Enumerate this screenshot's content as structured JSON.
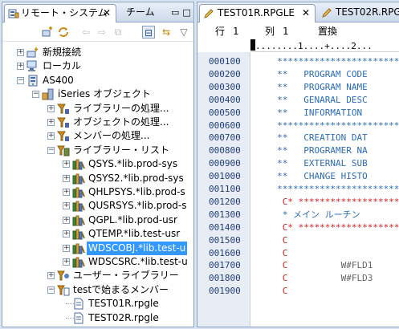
{
  "left_panel": {
    "tabs": [
      {
        "label": "リモート・システム",
        "icon": "remote-systems-icon",
        "active": true
      },
      {
        "label": "チーム",
        "active": false
      }
    ],
    "tree": [
      {
        "label": "新規接続",
        "icon": "new-connection-icon",
        "depth": 0,
        "expander": "+"
      },
      {
        "label": "ローカル",
        "icon": "local-icon",
        "depth": 0,
        "expander": "+"
      },
      {
        "label": "AS400",
        "icon": "server-icon",
        "depth": 0,
        "expander": "-"
      },
      {
        "label": "iSeries オブジェクト",
        "icon": "iseries-objects-icon",
        "depth": 1,
        "expander": "-"
      },
      {
        "label": "ライブラリーの処理...",
        "icon": "filter-icon",
        "depth": 2,
        "expander": "+"
      },
      {
        "label": "オブジェクトの処理...",
        "icon": "filter-icon",
        "depth": 2,
        "expander": "+"
      },
      {
        "label": "メンバーの処理...",
        "icon": "filter-icon",
        "depth": 2,
        "expander": "+"
      },
      {
        "label": "ライブラリー・リスト",
        "icon": "library-list-icon",
        "depth": 2,
        "expander": "-"
      },
      {
        "label": "QSYS.*lib.prod-sys",
        "icon": "library-icon",
        "depth": 3,
        "expander": "+"
      },
      {
        "label": "QSYS2.*lib.prod-sys",
        "icon": "library-icon",
        "depth": 3,
        "expander": "+"
      },
      {
        "label": "QHLPSYS.*lib.prod-s",
        "icon": "library-icon",
        "depth": 3,
        "expander": "+"
      },
      {
        "label": "QUSRSYS.*lib.prod-s",
        "icon": "library-icon",
        "depth": 3,
        "expander": "+"
      },
      {
        "label": "QGPL.*lib.prod-usr",
        "icon": "library-icon",
        "depth": 3,
        "expander": "+"
      },
      {
        "label": "QTEMP.*lib.test-usr",
        "icon": "library-icon",
        "depth": 3,
        "expander": "+"
      },
      {
        "label": "WDSCOBJ.*lib.test-u",
        "icon": "library-icon",
        "depth": 3,
        "expander": "+",
        "selected": true
      },
      {
        "label": "WDSCSRC.*lib.test-u",
        "icon": "library-icon",
        "depth": 3,
        "expander": "+"
      },
      {
        "label": "ユーザー・ライブラリー",
        "icon": "user-library-icon",
        "depth": 2,
        "expander": "+"
      },
      {
        "label": "testで始まるメンバー",
        "icon": "member-filter-icon",
        "depth": 2,
        "expander": "-"
      },
      {
        "label": "TEST01R.rpgle",
        "icon": "source-member-icon",
        "depth": 3,
        "expander": ""
      },
      {
        "label": "TEST02R.rpgle",
        "icon": "source-member-icon",
        "depth": 3,
        "expander": ""
      }
    ]
  },
  "editor": {
    "tabs": [
      {
        "label": "TEST01R.RPGLE",
        "icon": "pencil-icon",
        "active": true
      },
      {
        "label": "TEST02R.RPG",
        "icon": "pencil-icon",
        "active": false
      }
    ],
    "status": {
      "line_label": "行",
      "line_value": "1",
      "col_label": "列",
      "col_value": "1",
      "mode": "置換"
    },
    "ruler": "........1....+....2...",
    "lines": [
      {
        "seq": "000100",
        "spec": " ",
        "text": "     ***************************"
      },
      {
        "seq": "000200",
        "spec": " ",
        "text": "     **   PROGRAM CODE"
      },
      {
        "seq": "000300",
        "spec": " ",
        "text": "     **   PROGRAM NAME"
      },
      {
        "seq": "000400",
        "spec": " ",
        "text": "     **   GENARAL DESC"
      },
      {
        "seq": "000500",
        "spec": " ",
        "text": "     **   INFORMATION"
      },
      {
        "seq": "000600",
        "spec": " ",
        "text": "     ***************************"
      },
      {
        "seq": "000700",
        "spec": " ",
        "text": "     **   CREATION DAT"
      },
      {
        "seq": "000800",
        "spec": " ",
        "text": "     **   PROGRAMER NA"
      },
      {
        "seq": "000900",
        "spec": " ",
        "text": "     **   EXTERNAL SUB"
      },
      {
        "seq": "001000",
        "spec": " ",
        "text": "     **   CHANGE HISTO"
      },
      {
        "seq": "001100",
        "spec": " ",
        "text": "     ***************************"
      },
      {
        "seq": "001200",
        "spec": "C",
        "text": "* *************************"
      },
      {
        "seq": "001300",
        "spec": " ",
        "text": "      * メイン ルーチン"
      },
      {
        "seq": "001400",
        "spec": "C",
        "text": "* *************************"
      },
      {
        "seq": "001500",
        "spec": "C",
        "text": ""
      },
      {
        "seq": "001600",
        "spec": "C",
        "text": ""
      },
      {
        "seq": "001700",
        "spec": "C",
        "text": "          W#FLD1"
      },
      {
        "seq": "001800",
        "spec": "C",
        "text": "          W#FLD3"
      },
      {
        "seq": "001900",
        "spec": "C",
        "text": ""
      }
    ]
  },
  "colors": {
    "selection": "#3399ff",
    "spec_letter": "#d21d1d",
    "comment": "#2b6cb8",
    "sequence": "#1f3f7a"
  }
}
